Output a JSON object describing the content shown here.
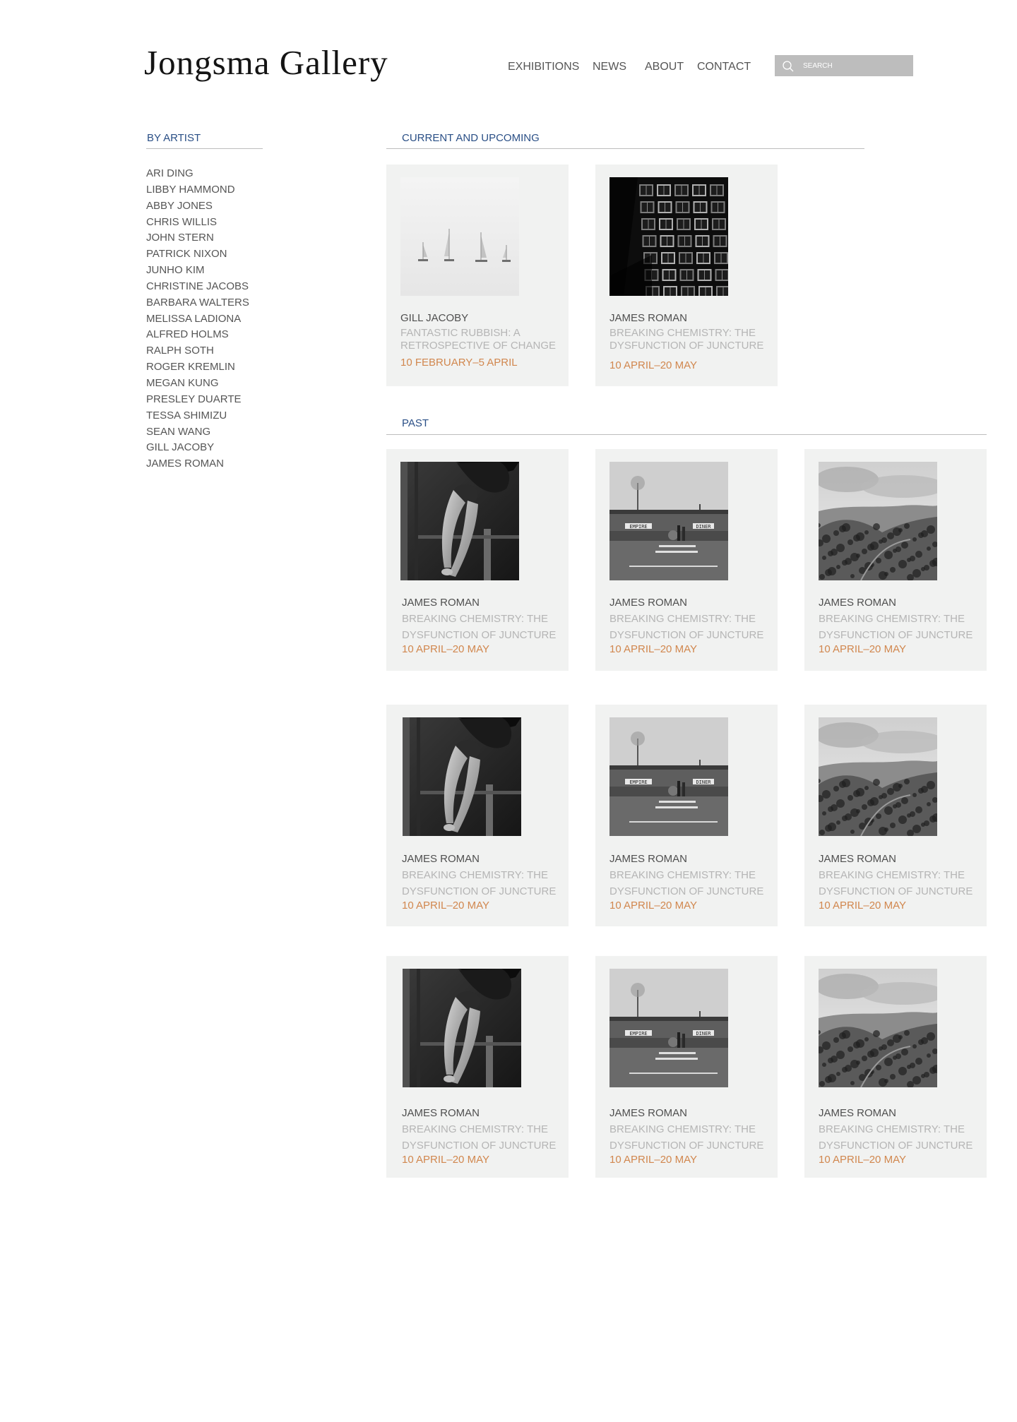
{
  "header": {
    "logo": "Jongsma Gallery",
    "nav": [
      "EXHIBITIONS",
      "NEWS",
      "ABOUT",
      "CONTACT"
    ],
    "search_placeholder": "SEARCH"
  },
  "sidebar": {
    "heading": "BY ARTIST",
    "artists": [
      "ARI DING",
      "LIBBY HAMMOND",
      "ABBY JONES",
      "CHRIS WILLIS",
      "JOHN STERN",
      "PATRICK NIXON",
      "JUNHO KIM",
      "CHRISTINE JACOBS",
      "BARBARA WALTERS",
      "MELISSA LADIONA",
      "ALFRED HOLMS",
      "RALPH SOTH",
      "ROGER KREMLIN",
      "MEGAN KUNG",
      "PRESLEY DUARTE",
      "TESSA SHIMIZU",
      "SEAN WANG",
      "GILL JACOBY",
      "JAMES ROMAN"
    ]
  },
  "current": {
    "heading": "CURRENT AND UPCOMING",
    "cards": [
      {
        "artist": "GILL JACOBY",
        "title_1": "FANTASTIC RUBBISH: A",
        "title_2": "RETROSPECTIVE OF CHANGE",
        "dates": "10 FEBRUARY–5 APRIL",
        "image": "sailboats-image"
      },
      {
        "artist": "JAMES ROMAN",
        "title_1": "BREAKING CHEMISTRY: THE",
        "title_2": "DYSFUNCTION OF JUNCTURE",
        "dates": "10 APRIL–20 MAY",
        "image": "building-image"
      }
    ]
  },
  "past": {
    "heading": "PAST",
    "cards": [
      {
        "artist": "JAMES ROMAN",
        "title_1": "BREAKING CHEMISTRY: THE",
        "title_2": "DYSFUNCTION OF JUNCTURE",
        "dates": "10 APRIL–20 MAY",
        "image": "dancer-image"
      },
      {
        "artist": "JAMES ROMAN",
        "title_1": "BREAKING CHEMISTRY: THE",
        "title_2": "DYSFUNCTION OF JUNCTURE",
        "dates": "10 APRIL–20 MAY",
        "image": "diner-image"
      },
      {
        "artist": "JAMES ROMAN",
        "title_1": "BREAKING CHEMISTRY: THE",
        "title_2": "DYSFUNCTION OF JUNCTURE",
        "dates": "10 APRIL–20 MAY",
        "image": "valley-image"
      },
      {
        "artist": "JAMES ROMAN",
        "title_1": "BREAKING CHEMISTRY: THE",
        "title_2": "DYSFUNCTION OF JUNCTURE",
        "dates": "10 APRIL–20 MAY",
        "image": "dancer-image"
      },
      {
        "artist": "JAMES ROMAN",
        "title_1": "BREAKING CHEMISTRY: THE",
        "title_2": "DYSFUNCTION OF JUNCTURE",
        "dates": "10 APRIL–20 MAY",
        "image": "diner-image"
      },
      {
        "artist": "JAMES ROMAN",
        "title_1": "BREAKING CHEMISTRY: THE",
        "title_2": "DYSFUNCTION OF JUNCTURE",
        "dates": "10 APRIL–20 MAY",
        "image": "valley-image"
      },
      {
        "artist": "JAMES ROMAN",
        "title_1": "BREAKING CHEMISTRY: THE",
        "title_2": "DYSFUNCTION OF JUNCTURE",
        "dates": "10 APRIL–20 MAY",
        "image": "dancer-image"
      },
      {
        "artist": "JAMES ROMAN",
        "title_1": "BREAKING CHEMISTRY: THE",
        "title_2": "DYSFUNCTION OF JUNCTURE",
        "dates": "10 APRIL–20 MAY",
        "image": "diner-image"
      },
      {
        "artist": "JAMES ROMAN",
        "title_1": "BREAKING CHEMISTRY: THE",
        "title_2": "DYSFUNCTION OF JUNCTURE",
        "dates": "10 APRIL–20 MAY",
        "image": "valley-image"
      }
    ]
  },
  "diner_sign": {
    "left": "EMPIRE",
    "right": "DINER"
  },
  "colors": {
    "heading": "#2a4f86",
    "artist_text": "#4f4f4f",
    "title_text": "#b5b5b5",
    "date_text": "#d1874e",
    "card_bg": "#f1f2f1",
    "search_bg": "#bdbdbd"
  }
}
